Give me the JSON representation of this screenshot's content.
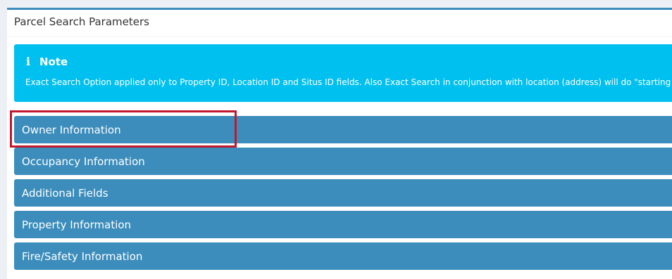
{
  "panel": {
    "title": "Parcel Search Parameters"
  },
  "note": {
    "icon": "info-icon",
    "title": "Note",
    "text": "Exact Search Option applied only to Property ID, Location ID and Situs ID fields. Also Exact Search in conjunction with location (address) will do \"starting with\""
  },
  "sections": [
    {
      "label": "Owner Information"
    },
    {
      "label": "Occupancy Information"
    },
    {
      "label": "Additional Fields"
    },
    {
      "label": "Property Information"
    },
    {
      "label": "Fire/Safety Information"
    }
  ],
  "colors": {
    "primary": "#3c8dbc",
    "info": "#00c0ef",
    "highlight": "#c0182f"
  }
}
